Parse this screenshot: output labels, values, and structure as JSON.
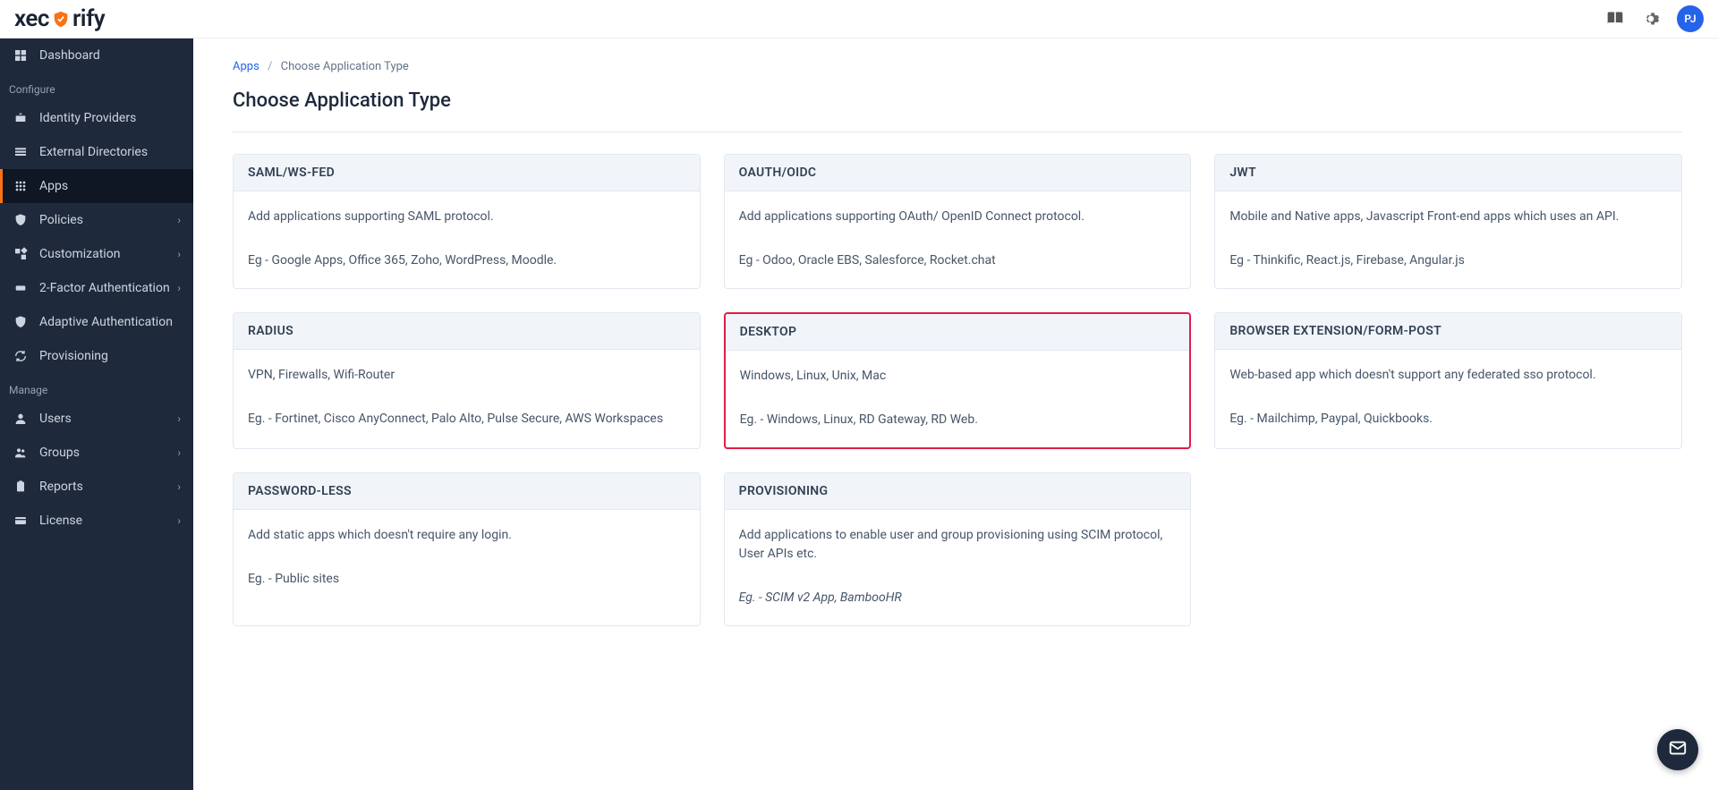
{
  "brand": "xecurify",
  "avatar_initials": "PJ",
  "sidebar": {
    "section_configure": "Configure",
    "section_manage": "Manage",
    "items": [
      {
        "label": "Dashboard"
      },
      {
        "label": "Identity Providers"
      },
      {
        "label": "External Directories"
      },
      {
        "label": "Apps"
      },
      {
        "label": "Policies"
      },
      {
        "label": "Customization"
      },
      {
        "label": "2-Factor Authentication"
      },
      {
        "label": "Adaptive Authentication"
      },
      {
        "label": "Provisioning"
      },
      {
        "label": "Users"
      },
      {
        "label": "Groups"
      },
      {
        "label": "Reports"
      },
      {
        "label": "License"
      }
    ]
  },
  "breadcrumb": {
    "root": "Apps",
    "current": "Choose Application Type"
  },
  "page_title": "Choose Application Type",
  "cards": [
    {
      "title": "SAML/WS-FED",
      "desc": "Add applications supporting SAML protocol.",
      "example": "Eg - Google Apps, Office 365, Zoho, WordPress, Moodle."
    },
    {
      "title": "OAUTH/OIDC",
      "desc": "Add applications supporting OAuth/ OpenID Connect protocol.",
      "example": "Eg - Odoo, Oracle EBS, Salesforce, Rocket.chat"
    },
    {
      "title": "JWT",
      "desc": "Mobile and Native apps, Javascript Front-end apps which uses an API.",
      "example": "Eg - Thinkific, React.js, Firebase, Angular.js"
    },
    {
      "title": "RADIUS",
      "desc": "VPN, Firewalls, Wifi-Router",
      "example": "Eg. - Fortinet, Cisco AnyConnect, Palo Alto, Pulse Secure, AWS Workspaces"
    },
    {
      "title": "DESKTOP",
      "desc": "Windows, Linux, Unix, Mac",
      "example": "Eg. - Windows, Linux, RD Gateway, RD Web."
    },
    {
      "title": "BROWSER EXTENSION/FORM-POST",
      "desc": "Web-based app which doesn't support any federated sso protocol.",
      "example": "Eg. - Mailchimp, Paypal, Quickbooks."
    },
    {
      "title": "PASSWORD-LESS",
      "desc": "Add static apps which doesn't require any login.",
      "example": "Eg. - Public sites"
    },
    {
      "title": "PROVISIONING",
      "desc": "Add applications to enable user and group provisioning using SCIM protocol, User APIs etc.",
      "example": "Eg. - SCIM v2 App, BambooHR"
    }
  ]
}
